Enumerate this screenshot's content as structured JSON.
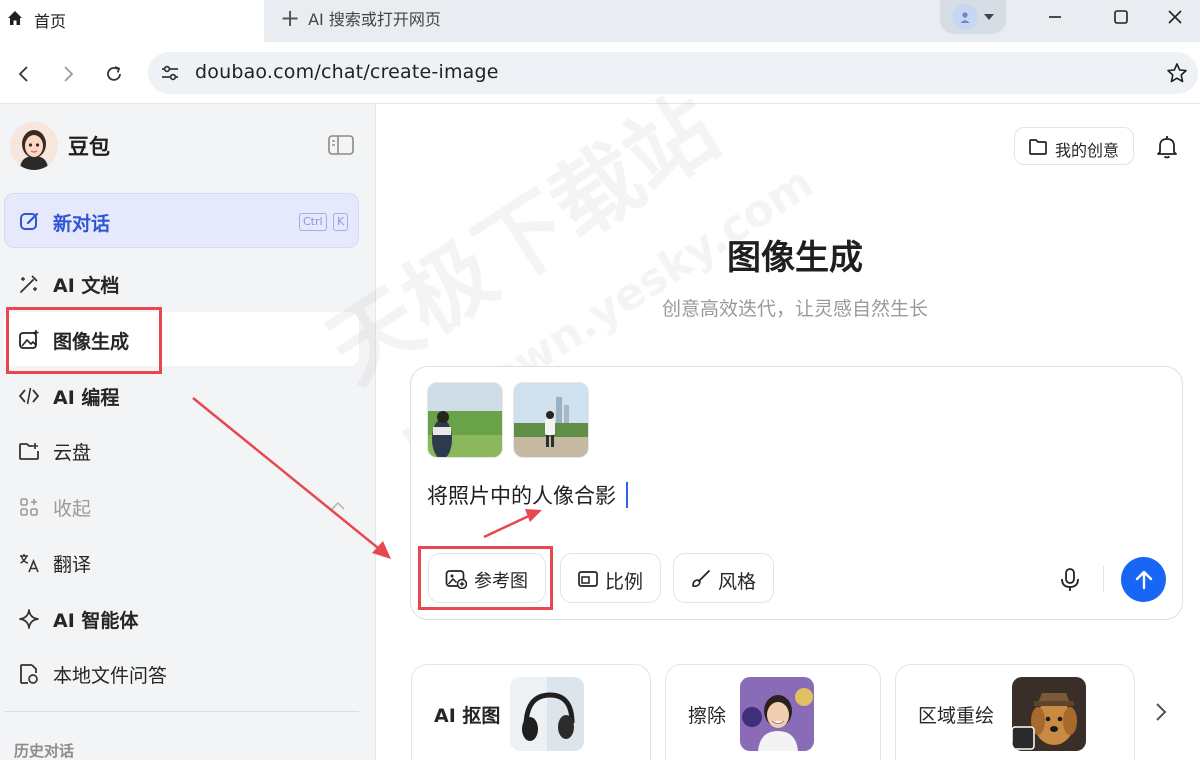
{
  "browser": {
    "tab_title": "首页",
    "new_tab_label": "AI 搜索或打开网页",
    "url": "doubao.com/chat/create-image"
  },
  "sidebar": {
    "brand": "豆包",
    "new_chat": {
      "label": "新对话",
      "shortcut_keys": [
        "Ctrl",
        "K"
      ]
    },
    "items": [
      {
        "label": "AI 文档",
        "icon": "magic-pen-icon"
      },
      {
        "label": "图像生成",
        "icon": "image-sparkle-icon",
        "selected": true
      },
      {
        "label": "AI 编程",
        "icon": "code-icon"
      },
      {
        "label": "云盘",
        "icon": "cloud-drive-icon"
      },
      {
        "label": "收起",
        "icon": "apps-grid-icon",
        "muted": true
      },
      {
        "label": "翻译",
        "icon": "translate-icon"
      },
      {
        "label": "AI 智能体",
        "icon": "sparkle-icon"
      },
      {
        "label": "本地文件问答",
        "icon": "local-file-icon"
      }
    ],
    "history_heading": "历史对话"
  },
  "main": {
    "my_creations": "我的创意",
    "title": "图像生成",
    "subtitle": "创意高效迭代，让灵感自然生长",
    "composer": {
      "prompt_text": "将照片中的人像合影",
      "options": [
        "参考图",
        "比例",
        "风格"
      ]
    },
    "feature_cards": [
      "AI 抠图",
      "擦除",
      "区域重绘"
    ]
  },
  "watermark": {
    "line1": "天极下载站",
    "line2": "mydown.yesky.com"
  },
  "colors": {
    "accent": "#1766f5",
    "new_chat_text": "#2f55d4",
    "new_chat_bg": "#e5e9fb",
    "annotation_red": "#e8474f",
    "sidebar_bg": "#f3f4f6"
  }
}
